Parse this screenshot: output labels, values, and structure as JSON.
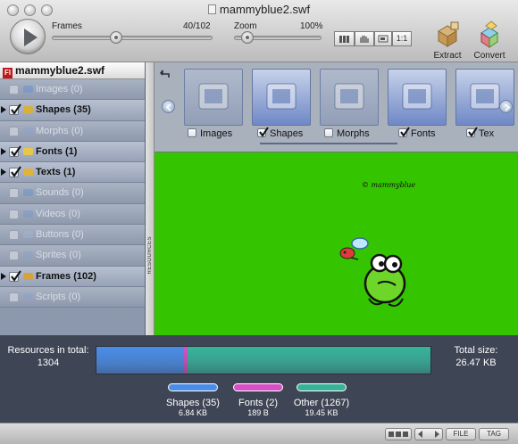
{
  "window": {
    "title": "mammyblue2.swf"
  },
  "toolbar": {
    "frames_label": "Frames",
    "frames_value": "40/102",
    "frames_progress": 0.39,
    "zoom_label": "Zoom",
    "zoom_value": "100%",
    "zoom_progress": 0.1,
    "fit_label": "1:1",
    "extract_label": "Extract",
    "convert_label": "Convert"
  },
  "sidebar": {
    "file_name": "mammyblue2.swf",
    "file_icon": "Fl",
    "items": [
      {
        "label": "Images (0)",
        "checked": false,
        "enabled": false,
        "expandable": false,
        "icon": "image-icon"
      },
      {
        "label": "Shapes (35)",
        "checked": true,
        "enabled": true,
        "expandable": true,
        "icon": "shapes-icon"
      },
      {
        "label": "Morphs (0)",
        "checked": false,
        "enabled": false,
        "expandable": false,
        "icon": "morph-icon"
      },
      {
        "label": "Fonts (1)",
        "checked": true,
        "enabled": true,
        "expandable": true,
        "icon": "font-icon"
      },
      {
        "label": "Texts (1)",
        "checked": true,
        "enabled": true,
        "expandable": true,
        "icon": "text-icon"
      },
      {
        "label": "Sounds (0)",
        "checked": false,
        "enabled": false,
        "expandable": false,
        "icon": "sound-icon"
      },
      {
        "label": "Videos (0)",
        "checked": false,
        "enabled": false,
        "expandable": false,
        "icon": "video-icon"
      },
      {
        "label": "Buttons (0)",
        "checked": false,
        "enabled": false,
        "expandable": false,
        "icon": "button-icon"
      },
      {
        "label": "Sprites (0)",
        "checked": false,
        "enabled": false,
        "expandable": false,
        "icon": "sprite-icon"
      },
      {
        "label": "Frames (102)",
        "checked": true,
        "enabled": true,
        "expandable": true,
        "icon": "frame-icon"
      },
      {
        "label": "Scripts (0)",
        "checked": false,
        "enabled": false,
        "expandable": false,
        "icon": "script-icon"
      }
    ],
    "splitter_label": "RESOURCES"
  },
  "resource_types": [
    {
      "label": "Images",
      "checked": false,
      "active": false
    },
    {
      "label": "Shapes",
      "checked": true,
      "active": true
    },
    {
      "label": "Morphs",
      "checked": false,
      "active": false
    },
    {
      "label": "Fonts",
      "checked": true,
      "active": true
    },
    {
      "label": "Tex",
      "checked": true,
      "active": true
    }
  ],
  "stage": {
    "copyright": "© mammyblue",
    "background": "#35c400"
  },
  "stats": {
    "resources_label": "Resources in total:",
    "resources_value": "1304",
    "total_label": "Total size:",
    "total_value": "26.47 KB",
    "legend": [
      {
        "name": "Shapes (35)",
        "size": "6.84 KB",
        "color": "#4a8de8",
        "share": 0.26
      },
      {
        "name": "Fonts (2)",
        "size": "189 B",
        "color": "#d64fc7",
        "share": 0.01
      },
      {
        "name": "Other (1267)",
        "size": "19.45 KB",
        "color": "#36b49a",
        "share": 0.73
      }
    ]
  },
  "footer": {
    "file_label": "FILE",
    "tag_label": "TAG"
  }
}
